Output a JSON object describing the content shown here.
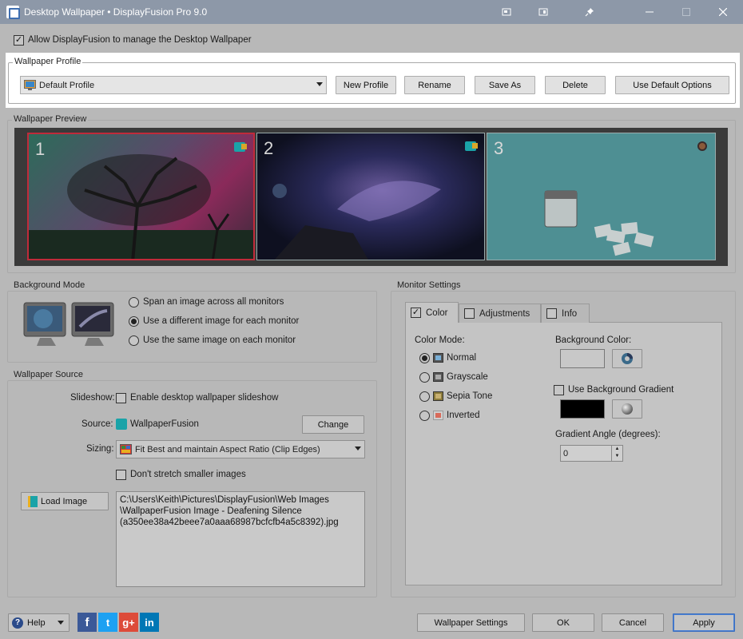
{
  "window": {
    "title": "Desktop Wallpaper • DisplayFusion Pro 9.0",
    "controls": [
      "restore-icon",
      "snap-icon",
      "pin-icon",
      "minimize-icon",
      "maximize-icon",
      "close-icon"
    ]
  },
  "manage": {
    "label": "Allow DisplayFusion to manage the Desktop Wallpaper",
    "checked": true
  },
  "profile": {
    "group_label": "Wallpaper Profile",
    "selected": "Default Profile",
    "buttons": {
      "new": "New Profile",
      "rename": "Rename",
      "save_as": "Save As",
      "delete": "Delete",
      "default": "Use Default Options"
    }
  },
  "preview": {
    "group_label": "Wallpaper Preview",
    "monitors": [
      {
        "number": "1",
        "selected": true
      },
      {
        "number": "2",
        "selected": false
      },
      {
        "number": "3",
        "selected": false
      }
    ]
  },
  "background_mode": {
    "group_label": "Background Mode",
    "options": [
      {
        "label": "Span an image across all monitors",
        "selected": false
      },
      {
        "label": "Use a different image for each monitor",
        "selected": true
      },
      {
        "label": "Use the same image on each monitor",
        "selected": false
      }
    ]
  },
  "source": {
    "group_label": "Wallpaper Source",
    "slideshow_label": "Slideshow:",
    "slideshow_option": "Enable desktop wallpaper slideshow",
    "source_label": "Source:",
    "source_value": "WallpaperFusion",
    "change_button": "Change",
    "sizing_label": "Sizing:",
    "sizing_value": "Fit Best and maintain Aspect Ratio (Clip Edges)",
    "no_stretch": "Don't stretch smaller images",
    "load_image": "Load Image",
    "path": "C:\\Users\\Keith\\Pictures\\DisplayFusion\\Web Images\n\\WallpaperFusion Image - Deafening Silence\n(a350ee38a42beee7a0aaa68987bcfcfb4a5c8392).jpg"
  },
  "monitor_settings": {
    "group_label": "Monitor Settings",
    "tabs": [
      {
        "label": "Color",
        "checked": true,
        "active": true
      },
      {
        "label": "Adjustments",
        "checked": false,
        "active": false
      },
      {
        "label": "Info",
        "checked": false,
        "active": false
      }
    ],
    "color_mode_label": "Color Mode:",
    "color_modes": [
      {
        "label": "Normal",
        "selected": true
      },
      {
        "label": "Grayscale",
        "selected": false
      },
      {
        "label": "Sepia Tone",
        "selected": false
      },
      {
        "label": "Inverted",
        "selected": false
      }
    ],
    "background_color_label": "Background Color:",
    "background_color": "#c8c8c8",
    "use_gradient_label": "Use Background Gradient",
    "gradient_color": "#000000",
    "gradient_angle_label": "Gradient Angle (degrees):",
    "gradient_angle": "0"
  },
  "footer": {
    "help": "Help",
    "social": [
      "f",
      "t",
      "g+",
      "in"
    ],
    "wallpaper_settings": "Wallpaper Settings",
    "ok": "OK",
    "cancel": "Cancel",
    "apply": "Apply"
  }
}
